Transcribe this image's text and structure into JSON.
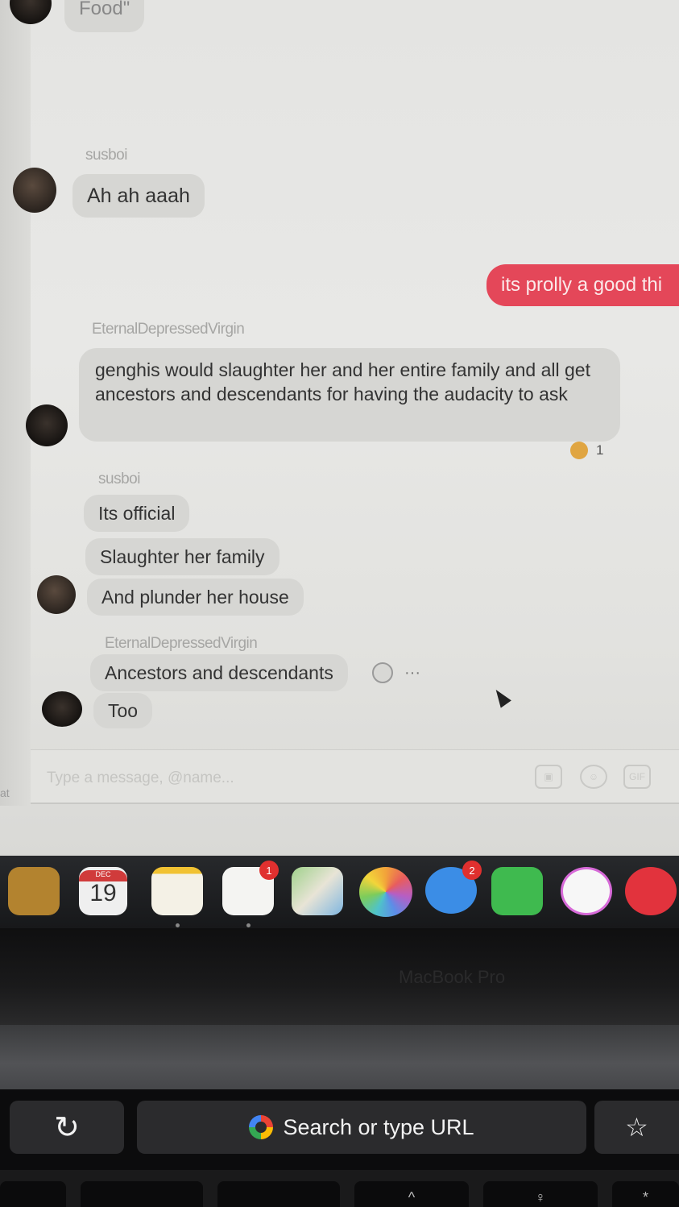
{
  "messages": {
    "top_partial": "Food\"",
    "group1": {
      "sender": "susboi",
      "text": "Ah ah aaah"
    },
    "outgoing": {
      "text": "its prolly a good thi"
    },
    "group2": {
      "sender": "EternalDepressedVirgin",
      "text": "genghis would slaughter her and her entire family and all get ancestors and descendants for having the audacity to ask",
      "reaction_count": "1"
    },
    "group3": {
      "sender": "susboi",
      "lines": [
        "Its official",
        "Slaughter her family",
        "And plunder her house"
      ]
    },
    "group4": {
      "sender": "EternalDepressedVirgin",
      "lines": [
        "Ancestors and descendants",
        "Too"
      ],
      "more_actions": "···"
    }
  },
  "composer": {
    "placeholder": "Type a message, @name...",
    "gif_label": "GIF"
  },
  "left_fragment": "at",
  "dock": {
    "calendar_month": "DEC",
    "calendar_day": "19",
    "reminders_badge": "1",
    "messages_badge": "2"
  },
  "bezel_brand": "MacBook Pro",
  "touchbar": {
    "search_label": "Search or type URL",
    "reload_glyph": "↻",
    "bookmark_glyph": "☆"
  },
  "keys": {
    "up_arrow": "^",
    "bulb": "♀",
    "asterisk": "*"
  },
  "colors": {
    "outgoing_bubble": "#e44759",
    "incoming_bubble": "#d6d6d3",
    "reaction": "#e0a541"
  }
}
